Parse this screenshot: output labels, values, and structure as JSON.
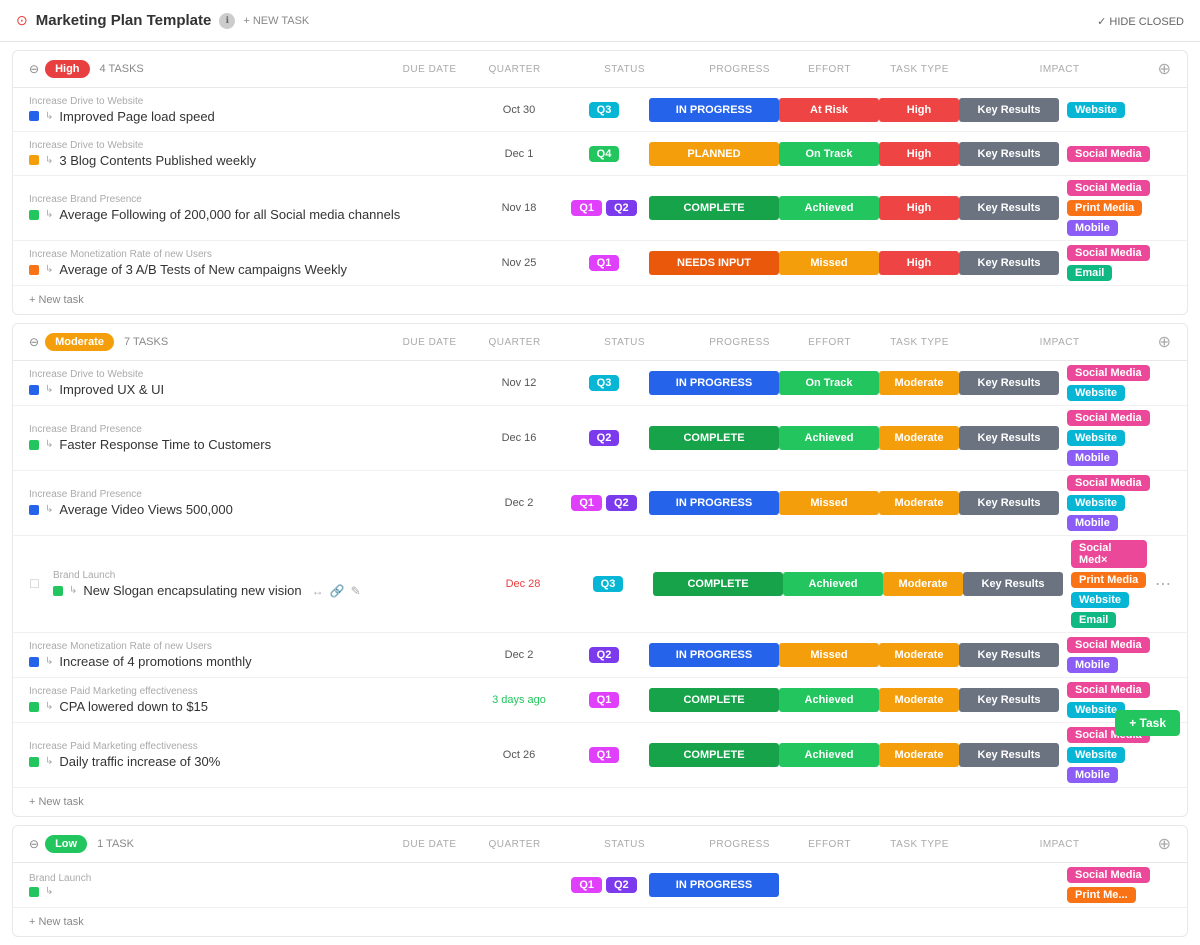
{
  "header": {
    "title": "Marketing Plan Template",
    "new_task": "+ NEW TASK",
    "hide_closed": "✓ HIDE CLOSED"
  },
  "columns": {
    "due_date": "DUE DATE",
    "quarter": "QUARTER",
    "status": "STATUS",
    "progress": "PROGRESS",
    "effort": "EFFORT",
    "task_type": "TASK TYPE",
    "impact": "IMPACT"
  },
  "groups": [
    {
      "priority": "High",
      "priority_class": "high",
      "task_count": "4 TASKS",
      "tasks": [
        {
          "parent": "Increase Drive to Website",
          "name": "Improved Page load speed",
          "color": "#2563eb",
          "due": "Oct 30",
          "due_class": "",
          "quarters": [
            "Q3"
          ],
          "quarter_classes": [
            "q3"
          ],
          "status": "IN PROGRESS",
          "status_class": "status-inprogress",
          "progress": "At Risk",
          "progress_class": "prog-atrisk",
          "effort": "High",
          "effort_class": "",
          "tasktype": "Key Results",
          "impact_tags": [
            {
              "label": "Website",
              "class": "tag-website"
            }
          ]
        },
        {
          "parent": "Increase Drive to Website",
          "name": "3 Blog Contents Published weekly",
          "color": "#f59e0b",
          "due": "Dec 1",
          "due_class": "",
          "quarters": [
            "Q4"
          ],
          "quarter_classes": [
            "q4"
          ],
          "status": "PLANNED",
          "status_class": "status-planned",
          "progress": "On Track",
          "progress_class": "prog-ontrack",
          "effort": "High",
          "effort_class": "",
          "tasktype": "Key Results",
          "impact_tags": [
            {
              "label": "Social Media",
              "class": "tag-socialmedia"
            }
          ]
        },
        {
          "parent": "Increase Brand Presence",
          "name": "Average Following of 200,000 for all Social media channels",
          "color": "#22c55e",
          "due": "Nov 18",
          "due_class": "",
          "quarters": [
            "Q1",
            "Q2"
          ],
          "quarter_classes": [
            "q1",
            "q2"
          ],
          "status": "COMPLETE",
          "status_class": "status-complete",
          "progress": "Achieved",
          "progress_class": "prog-achieved",
          "effort": "High",
          "effort_class": "",
          "tasktype": "Key Results",
          "impact_tags": [
            {
              "label": "Social Media",
              "class": "tag-socialmedia"
            },
            {
              "label": "Print Media",
              "class": "tag-printmedia"
            },
            {
              "label": "Mobile",
              "class": "tag-mobile"
            }
          ]
        },
        {
          "parent": "Increase Monetization Rate of new Users",
          "name": "Average of 3 A/B Tests of New campaigns Weekly",
          "color": "#f97316",
          "due": "Nov 25",
          "due_class": "",
          "quarters": [
            "Q1"
          ],
          "quarter_classes": [
            "q1"
          ],
          "status": "NEEDS INPUT",
          "status_class": "status-needsinput",
          "progress": "Missed",
          "progress_class": "prog-missed",
          "effort": "High",
          "effort_class": "",
          "tasktype": "Key Results",
          "impact_tags": [
            {
              "label": "Social Media",
              "class": "tag-socialmedia"
            },
            {
              "label": "Email",
              "class": "tag-email"
            }
          ]
        }
      ]
    },
    {
      "priority": "Moderate",
      "priority_class": "moderate",
      "task_count": "7 TASKS",
      "tasks": [
        {
          "parent": "Increase Drive to Website",
          "name": "Improved UX & UI",
          "color": "#2563eb",
          "due": "Nov 12",
          "due_class": "",
          "quarters": [
            "Q3"
          ],
          "quarter_classes": [
            "q3"
          ],
          "status": "IN PROGRESS",
          "status_class": "status-inprogress",
          "progress": "On Track",
          "progress_class": "prog-ontrack",
          "effort": "Moderate",
          "effort_class": "effort-moderate",
          "tasktype": "Key Results",
          "impact_tags": [
            {
              "label": "Social Media",
              "class": "tag-socialmedia"
            },
            {
              "label": "Website",
              "class": "tag-website"
            }
          ]
        },
        {
          "parent": "Increase Brand Presence",
          "name": "Faster Response Time to Customers",
          "color": "#22c55e",
          "due": "Dec 16",
          "due_class": "",
          "quarters": [
            "Q2"
          ],
          "quarter_classes": [
            "q2"
          ],
          "status": "COMPLETE",
          "status_class": "status-complete",
          "progress": "Achieved",
          "progress_class": "prog-achieved",
          "effort": "Moderate",
          "effort_class": "effort-moderate",
          "tasktype": "Key Results",
          "impact_tags": [
            {
              "label": "Social Media",
              "class": "tag-socialmedia"
            },
            {
              "label": "Website",
              "class": "tag-website"
            },
            {
              "label": "Mobile",
              "class": "tag-mobile"
            }
          ]
        },
        {
          "parent": "Increase Brand Presence",
          "name": "Average Video Views 500,000",
          "color": "#2563eb",
          "due": "Dec 2",
          "due_class": "",
          "quarters": [
            "Q1",
            "Q2"
          ],
          "quarter_classes": [
            "q1",
            "q2"
          ],
          "status": "IN PROGRESS",
          "status_class": "status-inprogress",
          "progress": "Missed",
          "progress_class": "prog-missed",
          "effort": "Moderate",
          "effort_class": "effort-moderate",
          "tasktype": "Key Results",
          "impact_tags": [
            {
              "label": "Social Media",
              "class": "tag-socialmedia"
            },
            {
              "label": "Website",
              "class": "tag-website"
            },
            {
              "label": "Mobile",
              "class": "tag-mobile"
            }
          ]
        },
        {
          "parent": "Brand Launch",
          "name": "New Slogan encapsulating new vision",
          "color": "#22c55e",
          "due": "Dec 28",
          "due_class": "overdue",
          "quarters": [
            "Q3"
          ],
          "quarter_classes": [
            "q3"
          ],
          "status": "COMPLETE",
          "status_class": "status-complete",
          "progress": "Achieved",
          "progress_class": "prog-achieved",
          "effort": "Moderate",
          "effort_class": "effort-moderate",
          "tasktype": "Key Results",
          "impact_tags": [
            {
              "label": "Social Med×",
              "class": "tag-socialmedia"
            },
            {
              "label": "Print Media",
              "class": "tag-printmedia"
            },
            {
              "label": "Website",
              "class": "tag-website"
            },
            {
              "label": "Email",
              "class": "tag-email"
            }
          ],
          "has_actions": true
        },
        {
          "parent": "Increase Monetization Rate of new Users",
          "name": "Increase of 4 promotions monthly",
          "color": "#2563eb",
          "due": "Dec 2",
          "due_class": "",
          "quarters": [
            "Q2"
          ],
          "quarter_classes": [
            "q2"
          ],
          "status": "IN PROGRESS",
          "status_class": "status-inprogress",
          "progress": "Missed",
          "progress_class": "prog-missed",
          "effort": "Moderate",
          "effort_class": "effort-moderate",
          "tasktype": "Key Results",
          "impact_tags": [
            {
              "label": "Social Media",
              "class": "tag-socialmedia"
            },
            {
              "label": "Mobile",
              "class": "tag-mobile"
            }
          ]
        },
        {
          "parent": "Increase Paid Marketing effectiveness",
          "name": "CPA lowered down to $15",
          "color": "#22c55e",
          "due": "3 days ago",
          "due_class": "soon",
          "quarters": [
            "Q1"
          ],
          "quarter_classes": [
            "q1"
          ],
          "status": "COMPLETE",
          "status_class": "status-complete",
          "progress": "Achieved",
          "progress_class": "prog-achieved",
          "effort": "Moderate",
          "effort_class": "effort-moderate",
          "tasktype": "Key Results",
          "impact_tags": [
            {
              "label": "Social Media",
              "class": "tag-socialmedia"
            },
            {
              "label": "Website",
              "class": "tag-website"
            }
          ]
        },
        {
          "parent": "Increase Paid Marketing effectiveness",
          "name": "Daily traffic increase of 30%",
          "color": "#22c55e",
          "due": "Oct 26",
          "due_class": "",
          "quarters": [
            "Q1"
          ],
          "quarter_classes": [
            "q1"
          ],
          "status": "COMPLETE",
          "status_class": "status-complete",
          "progress": "Achieved",
          "progress_class": "prog-achieved",
          "effort": "Moderate",
          "effort_class": "effort-moderate",
          "tasktype": "Key Results",
          "impact_tags": [
            {
              "label": "Social Media",
              "class": "tag-socialmedia"
            },
            {
              "label": "Website",
              "class": "tag-website"
            },
            {
              "label": "Mobile",
              "class": "tag-mobile"
            }
          ]
        }
      ]
    },
    {
      "priority": "Low",
      "priority_class": "low",
      "task_count": "1 TASK",
      "tasks": [
        {
          "parent": "Brand Launch",
          "name": "",
          "color": "#22c55e",
          "due": "",
          "due_class": "",
          "quarters": [
            "Q1",
            "Q2"
          ],
          "quarter_classes": [
            "q1",
            "q2"
          ],
          "status": "IN PROGRESS",
          "status_class": "status-inprogress",
          "progress": "",
          "progress_class": "",
          "effort": "",
          "effort_class": "",
          "tasktype": "",
          "impact_tags": [
            {
              "label": "Social Media",
              "class": "tag-socialmedia"
            },
            {
              "label": "Print Me...",
              "class": "tag-printmedia"
            }
          ]
        }
      ]
    }
  ],
  "add_task_label": "+ New task",
  "add_task_bottom": "+ Task"
}
